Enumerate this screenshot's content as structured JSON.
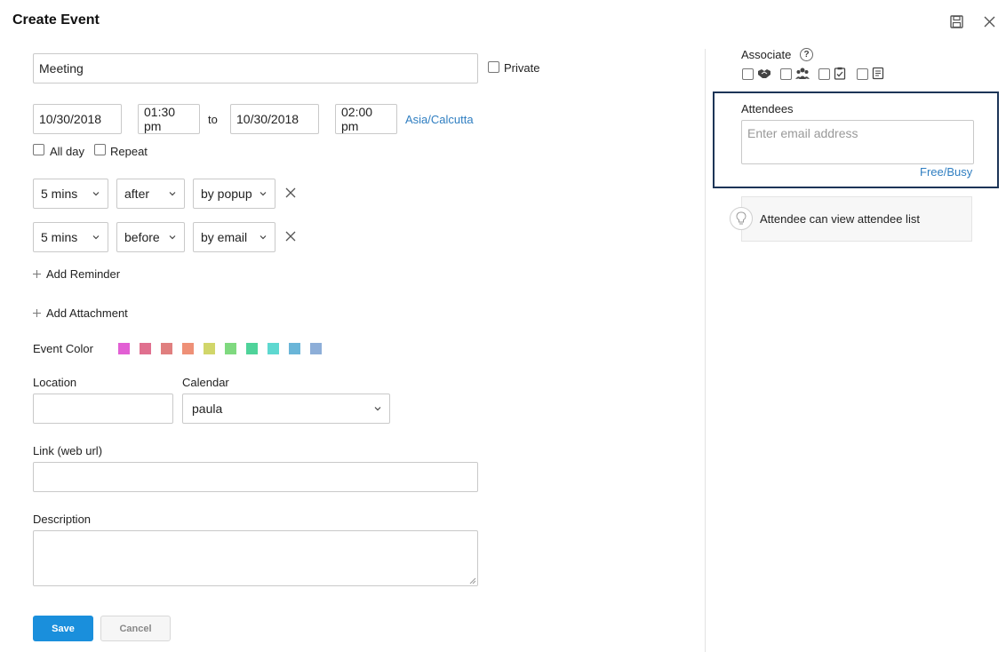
{
  "header": {
    "title": "Create Event",
    "save_icon": "floppy-disk-icon",
    "close_icon": "close-icon"
  },
  "form": {
    "title_value": "Meeting",
    "private_label": "Private",
    "start_date": "10/30/2018",
    "start_time": "01:30 pm",
    "to_label": "to",
    "end_date": "10/30/2018",
    "end_time": "02:00 pm",
    "timezone": "Asia/Calcutta",
    "all_day_label": "All day",
    "repeat_label": "Repeat",
    "reminders": [
      {
        "duration": "5 mins",
        "relation": "after",
        "method": "by popup"
      },
      {
        "duration": "5 mins",
        "relation": "before",
        "method": "by email"
      }
    ],
    "add_reminder_label": "Add Reminder",
    "add_attachment_label": "Add Attachment",
    "event_color_label": "Event Color",
    "event_colors": [
      "#e25fd4",
      "#e0708f",
      "#e07f7f",
      "#ee9077",
      "#d1d66a",
      "#7fd97f",
      "#4fd39a",
      "#5ed8d0",
      "#6ab5d8",
      "#8daed8"
    ],
    "location_label": "Location",
    "location_value": "",
    "calendar_label": "Calendar",
    "calendar_value": "paula",
    "link_label": "Link (web url)",
    "link_value": "",
    "description_label": "Description",
    "description_value": "",
    "save_label": "Save",
    "cancel_label": "Cancel"
  },
  "sidebar": {
    "associate_label": "Associate",
    "help_icon_text": "?",
    "associate_icons": [
      "handshake-icon",
      "group-icon",
      "task-clipboard-icon",
      "note-icon"
    ],
    "attendees_label": "Attendees",
    "attendees_placeholder": "Enter email address",
    "free_busy_label": "Free/Busy",
    "tip_text": "Attendee can view attendee list"
  }
}
